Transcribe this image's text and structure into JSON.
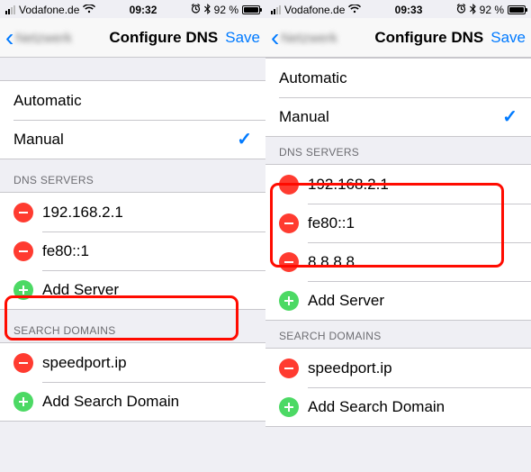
{
  "left": {
    "status": {
      "carrier": "Vodafone.de",
      "time": "09:32",
      "battery_pct": "92 %"
    },
    "nav": {
      "back_label": "Netzwerk",
      "title": "Configure DNS",
      "save": "Save"
    },
    "config": {
      "automatic": "Automatic",
      "manual": "Manual",
      "selected": "manual"
    },
    "headers": {
      "dns": "DNS SERVERS",
      "domains": "SEARCH DOMAINS"
    },
    "dns": [
      {
        "value": "192.168.2.1"
      },
      {
        "value": "fe80::1"
      }
    ],
    "add_server": "Add Server",
    "domains": [
      {
        "value": "speedport.ip"
      }
    ],
    "add_domain": "Add Search Domain"
  },
  "right": {
    "status": {
      "carrier": "Vodafone.de",
      "time": "09:33",
      "battery_pct": "92 %"
    },
    "nav": {
      "back_label": "Netzwerk",
      "title": "Configure DNS",
      "save": "Save"
    },
    "config": {
      "automatic": "Automatic",
      "manual": "Manual",
      "selected": "manual"
    },
    "headers": {
      "dns": "DNS SERVERS",
      "domains": "SEARCH DOMAINS"
    },
    "dns": [
      {
        "value": "192.168.2.1"
      },
      {
        "value": "fe80::1"
      },
      {
        "value": "8.8.8.8"
      }
    ],
    "add_server": "Add Server",
    "domains": [
      {
        "value": "speedport.ip"
      }
    ],
    "add_domain": "Add Search Domain"
  },
  "colors": {
    "accent": "#007AFF",
    "delete": "#FF3B30",
    "add": "#4CD964",
    "highlight": "#FF0B00"
  }
}
